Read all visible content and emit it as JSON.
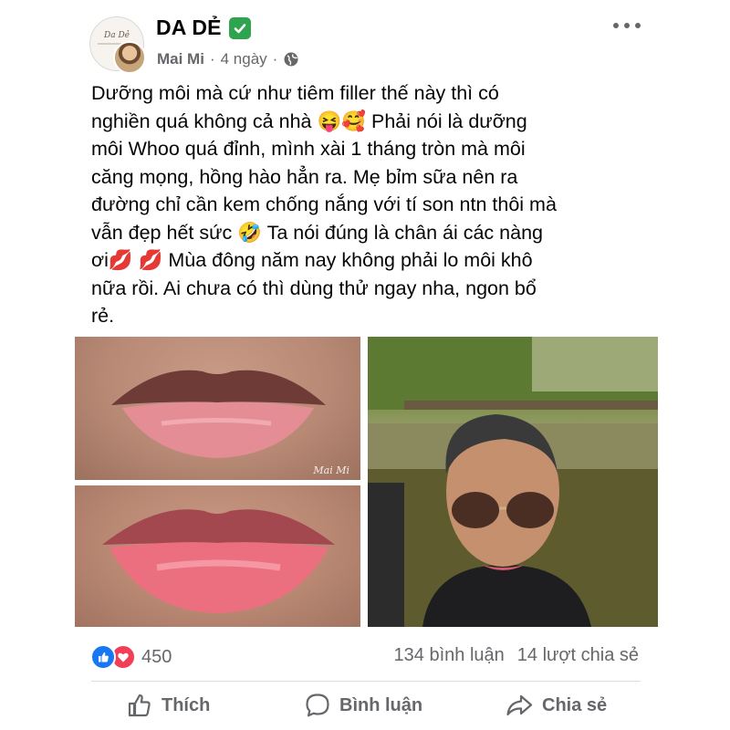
{
  "post": {
    "page_name": "DA DẺ",
    "verified_emoji": "✅",
    "avatar_text": "Da Dẻ",
    "author": "Mai Mi",
    "separator": "·",
    "time": "4 ngày",
    "separator2": "·",
    "text": "Dưỡng môi mà cứ như tiêm filler thế này thì có\nnghiền quá không cả nhà 😝🥰 Phải nói là dưỡng\nmôi Whoo quá đỉnh, mình xài 1 tháng tròn mà môi\ncăng mọng, hồng hào hẳn ra. Mẹ bỉm sữa nên ra\nđường chỉ cần kem chống nắng với tí son ntn thôi mà\nvẫn đẹp hết sức 🤣 Ta nói đúng là chân ái các nàng\nơi💋 💋 Mùa đông năm nay không phải lo môi khô\nnữa rồi. Ai chưa có thì dùng thử ngay nha, ngon bổ\nrẻ.",
    "watermark": "Mai Mi"
  },
  "reactions": {
    "count": "450",
    "comments": "134 bình luận",
    "shares": "14 lượt chia sẻ"
  },
  "actions": {
    "like": "Thích",
    "comment": "Bình luận",
    "share": "Chia sẻ"
  },
  "colors": {
    "like_blue": "#1877f2",
    "love_red": "#f33e58",
    "muted_text": "#65676b",
    "verified_green": "#2ea44f"
  }
}
